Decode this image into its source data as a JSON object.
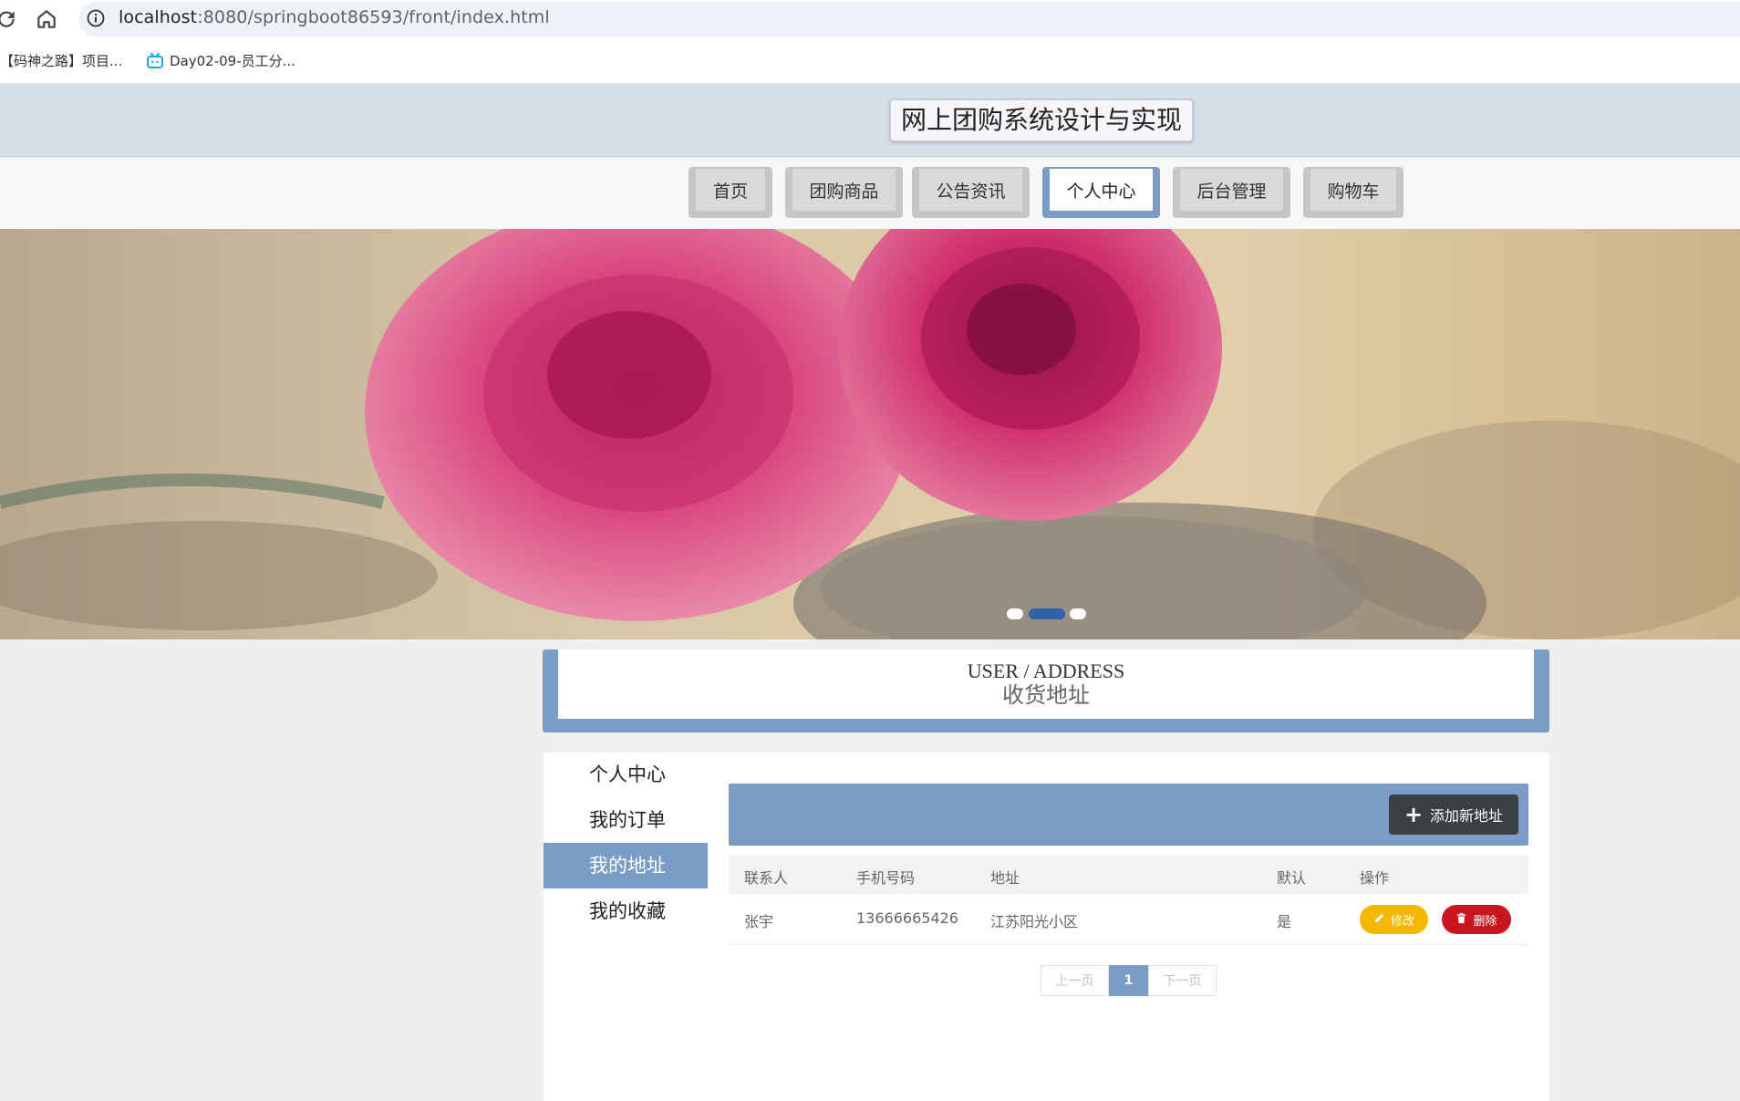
{
  "browser": {
    "url_host": "localhost",
    "url_path": ":8080/springboot86593/front/index.html",
    "bookmarks": [
      {
        "label": "【码神之路】项目..."
      },
      {
        "label": "Day02-09-员工分..."
      }
    ]
  },
  "site": {
    "title": "网上团购系统设计与实现",
    "nav": [
      {
        "label": "首页",
        "active": false
      },
      {
        "label": "团购商品",
        "active": false
      },
      {
        "label": "公告资讯",
        "active": false
      },
      {
        "label": "个人中心",
        "active": true
      },
      {
        "label": "后台管理",
        "active": false
      },
      {
        "label": "购物车",
        "active": false
      }
    ]
  },
  "banner": {
    "slides": 3,
    "active_slide": 2
  },
  "section": {
    "title_en": "USER / ADDRESS",
    "title_cn": "收货地址"
  },
  "sidebar": {
    "items": [
      {
        "label": "个人中心",
        "active": false
      },
      {
        "label": "我的订单",
        "active": false
      },
      {
        "label": "我的地址",
        "active": true
      },
      {
        "label": "我的收藏",
        "active": false
      }
    ]
  },
  "toolbar": {
    "add_label": "添加新地址"
  },
  "table": {
    "headers": [
      "联系人",
      "手机号码",
      "地址",
      "默认",
      "操作"
    ],
    "rows": [
      {
        "contact": "张宇",
        "phone": "13666665426",
        "address": "江苏阳光小区",
        "is_default": "是"
      }
    ],
    "edit_label": "修改",
    "delete_label": "删除"
  },
  "pagination": {
    "prev": "上一页",
    "current": "1",
    "next": "下一页"
  },
  "colors": {
    "accent": "#7b9cc7",
    "edit": "#f5b800",
    "delete": "#c9151e",
    "dark_button": "#3b3f42"
  }
}
